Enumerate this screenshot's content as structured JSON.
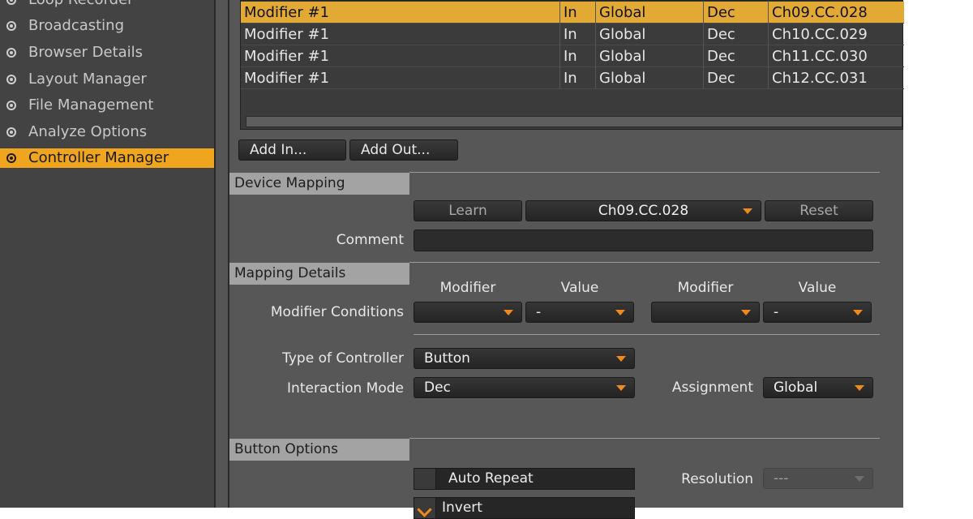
{
  "sidebar": {
    "items": [
      {
        "label": "Loop Recorder",
        "active": false
      },
      {
        "label": "Broadcasting",
        "active": false
      },
      {
        "label": "Browser Details",
        "active": false
      },
      {
        "label": "Layout Manager",
        "active": false
      },
      {
        "label": "File Management",
        "active": false
      },
      {
        "label": "Analyze Options",
        "active": false
      },
      {
        "label": "Controller Manager",
        "active": true
      }
    ]
  },
  "mapping_table": {
    "rows": [
      {
        "name": "Modifier #1",
        "io": "In",
        "deck": "Global",
        "mode": "Dec",
        "control": "Ch09.CC.028",
        "selected": true
      },
      {
        "name": "Modifier #1",
        "io": "In",
        "deck": "Global",
        "mode": "Dec",
        "control": "Ch10.CC.029",
        "selected": false
      },
      {
        "name": "Modifier #1",
        "io": "In",
        "deck": "Global",
        "mode": "Dec",
        "control": "Ch11.CC.030",
        "selected": false
      },
      {
        "name": "Modifier #1",
        "io": "In",
        "deck": "Global",
        "mode": "Dec",
        "control": "Ch12.CC.031",
        "selected": false
      }
    ]
  },
  "buttons": {
    "add_in": "Add In...",
    "add_out": "Add Out..."
  },
  "device_mapping": {
    "header": "Device Mapping",
    "learn": "Learn",
    "control": "Ch09.CC.028",
    "reset": "Reset",
    "comment_label": "Comment",
    "comment_value": ""
  },
  "mapping_details": {
    "header": "Mapping Details",
    "col_modifier_1": "Modifier",
    "col_value_1": "Value",
    "col_modifier_2": "Modifier",
    "col_value_2": "Value",
    "conditions_label": "Modifier Conditions",
    "cond1_modifier": "",
    "cond1_value": "-",
    "cond2_modifier": "",
    "cond2_value": "-",
    "type_label": "Type of Controller",
    "type_value": "Button",
    "interaction_label": "Interaction Mode",
    "interaction_value": "Dec",
    "assignment_label": "Assignment",
    "assignment_value": "Global"
  },
  "button_options": {
    "header": "Button Options",
    "auto_repeat": "Auto Repeat",
    "auto_repeat_checked": false,
    "invert": "Invert",
    "invert_checked": true,
    "resolution_label": "Resolution",
    "resolution_value": "---"
  },
  "colors": {
    "accent": "#f0a51e",
    "caret": "#f08a1c",
    "panel": "#575757",
    "sidebar": "#434343"
  }
}
